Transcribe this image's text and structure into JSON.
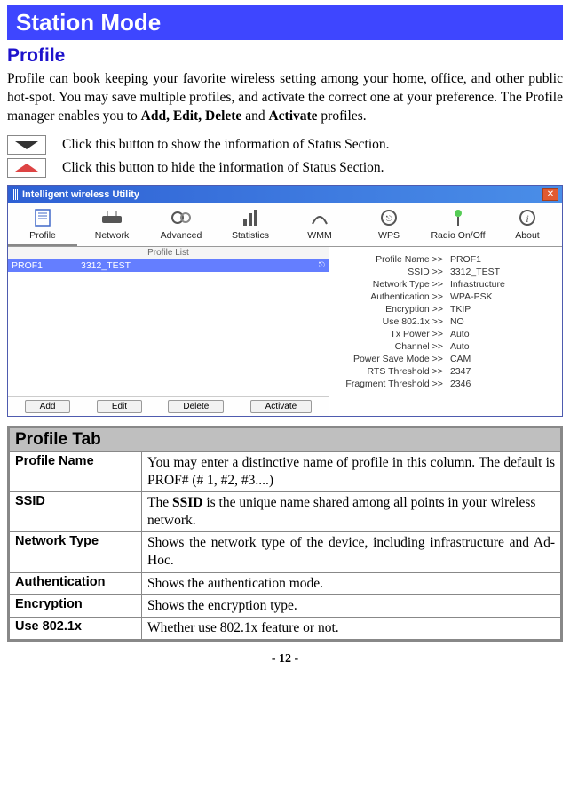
{
  "section_title": "Station Mode",
  "subheading": "Profile",
  "intro_html": "Profile can book keeping your favorite wireless setting among your home, office, and other public hot-spot. You may save multiple profiles, and activate the correct one at your preference. The Profile manager enables you to <b>Add, Edit, Delete</b> and <b>Activate</b> profiles.",
  "icon_down_desc": "Click this button to show the information of Status Section.",
  "icon_up_desc": "Click this button to hide the information of Status Section.",
  "app": {
    "window_title": "Intelligent wireless Utility",
    "tabs": [
      {
        "label": "Profile",
        "icon": "profile"
      },
      {
        "label": "Network",
        "icon": "network"
      },
      {
        "label": "Advanced",
        "icon": "advanced"
      },
      {
        "label": "Statistics",
        "icon": "statistics"
      },
      {
        "label": "WMM",
        "icon": "wmm"
      },
      {
        "label": "WPS",
        "icon": "wps"
      },
      {
        "label": "Radio On/Off",
        "icon": "radio"
      },
      {
        "label": "About",
        "icon": "about"
      }
    ],
    "profile_list_header": "Profile List",
    "profile_row": {
      "name": "PROF1",
      "ssid": "3312_TEST"
    },
    "buttons": {
      "add": "Add",
      "edit": "Edit",
      "delete": "Delete",
      "activate": "Activate"
    },
    "details": [
      {
        "k": "Profile Name >>",
        "v": "PROF1"
      },
      {
        "k": "SSID >>",
        "v": "3312_TEST"
      },
      {
        "k": "Network Type >>",
        "v": "Infrastructure"
      },
      {
        "k": "Authentication >>",
        "v": "WPA-PSK"
      },
      {
        "k": "Encryption >>",
        "v": "TKIP"
      },
      {
        "k": "Use 802.1x >>",
        "v": "NO"
      },
      {
        "k": "Tx Power >>",
        "v": "Auto"
      },
      {
        "k": "Channel >>",
        "v": "Auto"
      },
      {
        "k": "Power Save Mode >>",
        "v": "CAM"
      },
      {
        "k": "RTS Threshold >>",
        "v": "2347"
      },
      {
        "k": "Fragment Threshold >>",
        "v": "2346"
      }
    ]
  },
  "table_header": "Profile Tab",
  "rows": [
    {
      "label": "Profile Name",
      "desc": "You may enter a distinctive name of profile in this column. The default is PROF# (# 1, #2, #3....)",
      "justify": true
    },
    {
      "label": "SSID",
      "desc_html": "The <b>SSID</b> is the unique name shared among all points in your wireless network."
    },
    {
      "label": "Network Type",
      "desc": "Shows the network type of the device, including infrastructure and Ad-Hoc.",
      "justify": true
    },
    {
      "label": "Authentication",
      "desc": "Shows the authentication mode."
    },
    {
      "label": "Encryption",
      "desc": "Shows the encryption type."
    },
    {
      "label": "Use 802.1x",
      "desc": "Whether use 802.1x feature or not."
    }
  ],
  "page_number": "- 12 -"
}
